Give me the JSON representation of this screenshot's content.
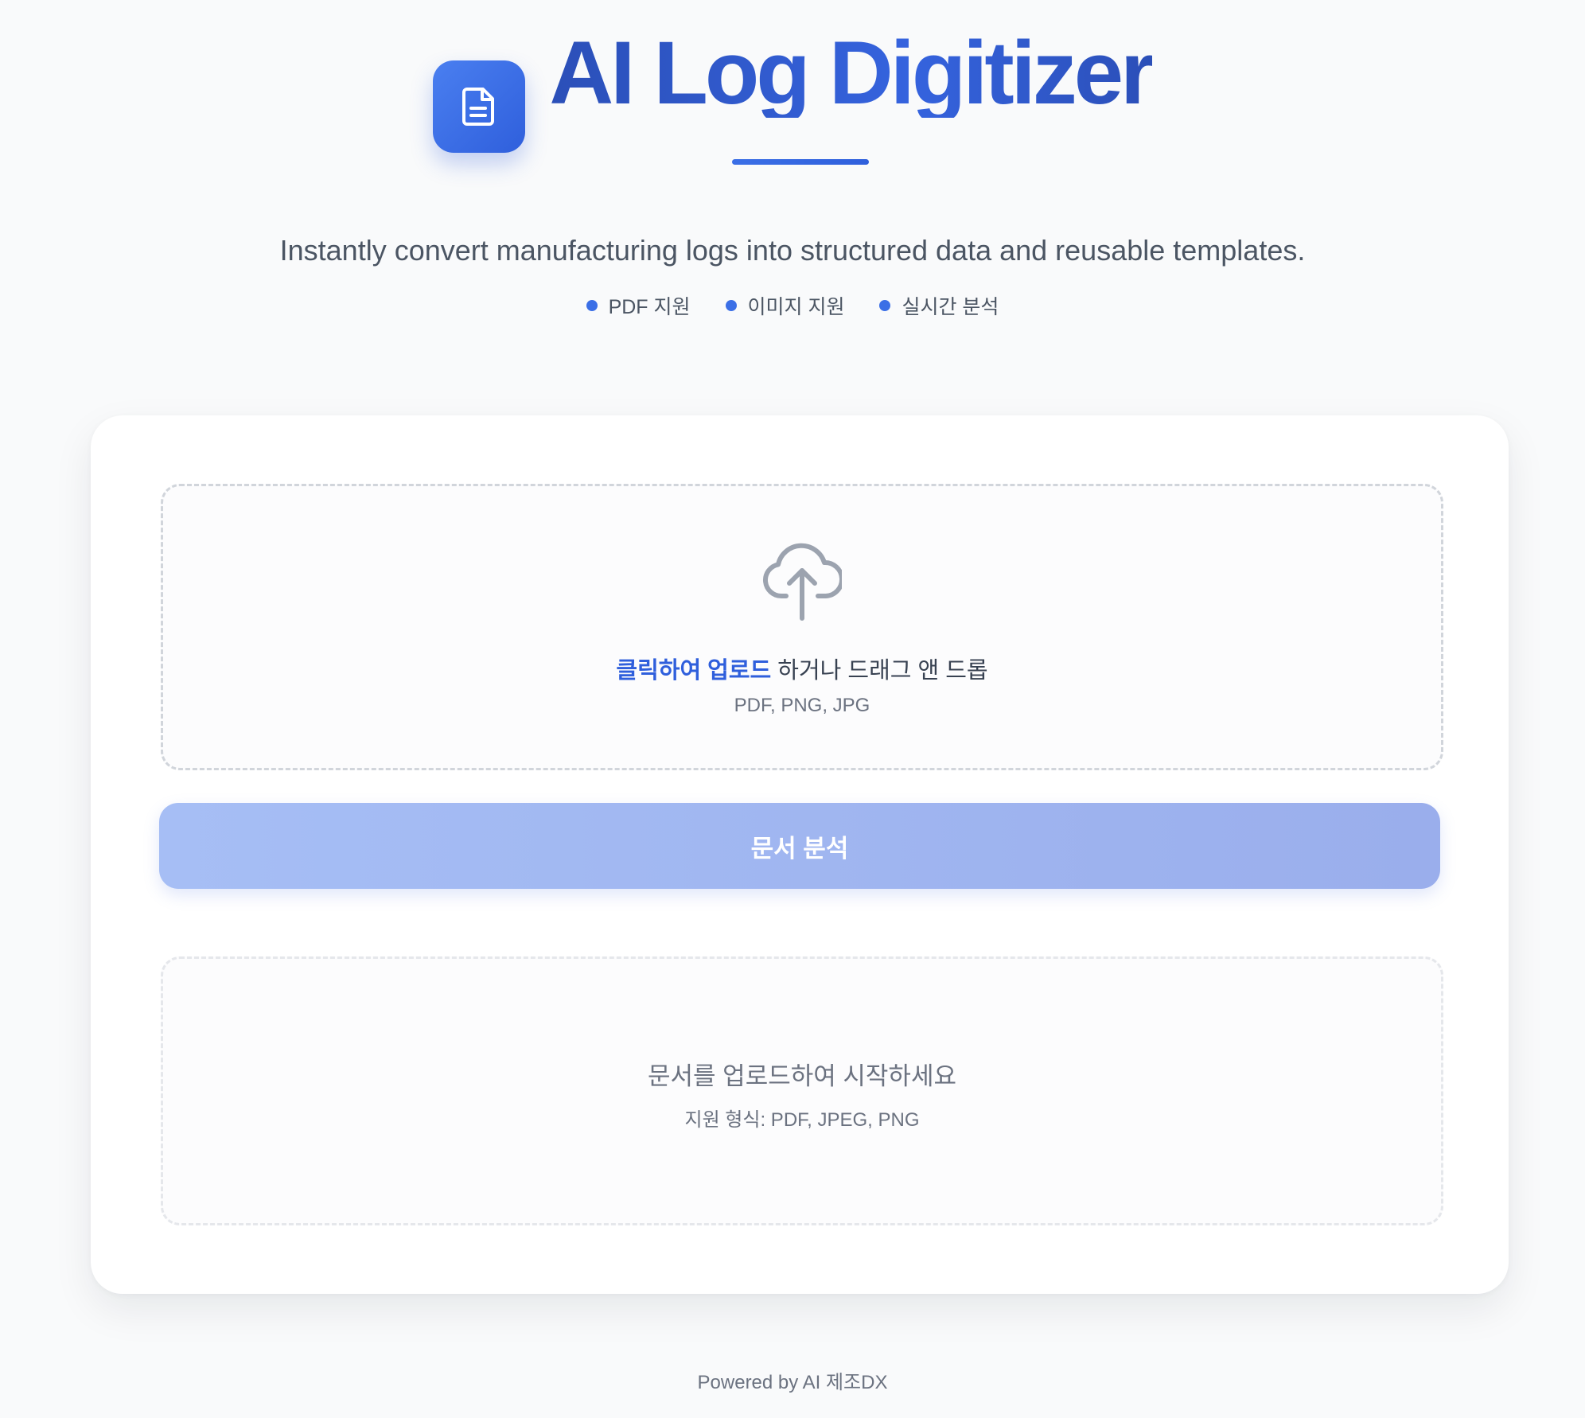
{
  "header": {
    "title": "AI Log Digitizer",
    "subtitle": "Instantly convert manufacturing logs into structured data and reusable templates.",
    "logo_icon": "document-icon",
    "features": [
      {
        "label": "PDF 지원"
      },
      {
        "label": "이미지 지원"
      },
      {
        "label": "실시간 분석"
      }
    ]
  },
  "upload": {
    "icon": "cloud-upload-icon",
    "link_text": "클릭하여 업로드",
    "rest_text": " 하거나 드래그 앤 드롭",
    "formats": "PDF, PNG, JPG"
  },
  "analyze_button": {
    "label": "문서 분석"
  },
  "result": {
    "title": "문서를 업로드하여 시작하세요",
    "subtitle": "지원 형식: PDF, JPEG, PNG"
  },
  "footer": {
    "text": "Powered by AI 제조DX"
  },
  "colors": {
    "accent": "#2f5fdc",
    "background": "#f9fafb",
    "button": "#a6bef5"
  }
}
